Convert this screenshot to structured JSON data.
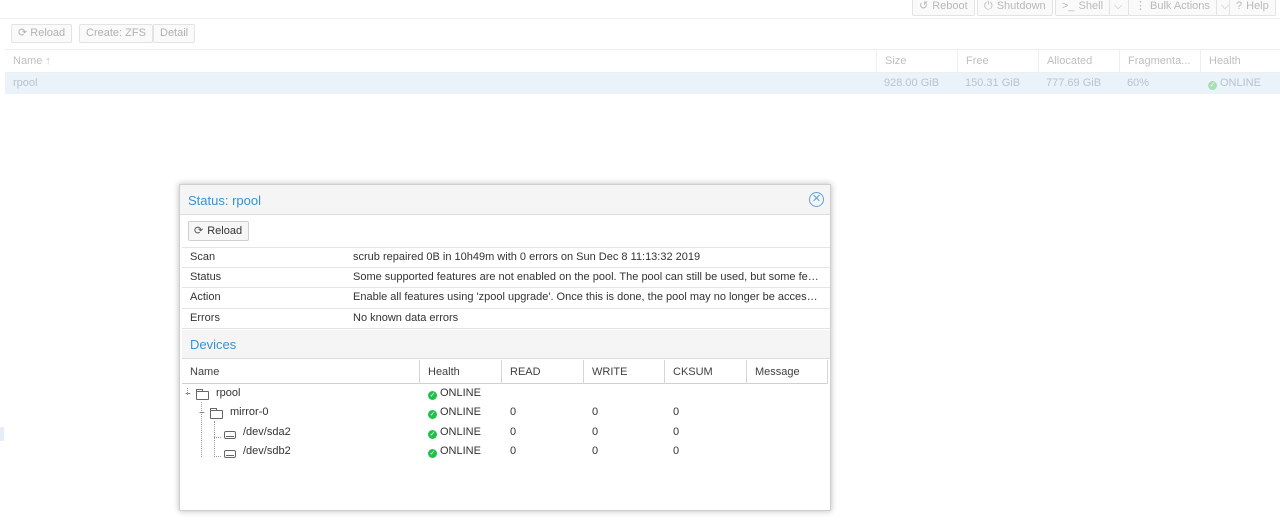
{
  "topbar": {
    "buttons": [
      {
        "icon": "undo-icon",
        "glyph": "↺",
        "label": "Reboot"
      },
      {
        "icon": "power-icon",
        "glyph": "⏻",
        "label": "Shutdown"
      },
      {
        "icon": "terminal-icon",
        "glyph": ">_",
        "label": "Shell",
        "has_dropdown": true
      },
      {
        "icon": "ellipsis-vertical-icon",
        "glyph": "⋮",
        "label": "Bulk Actions",
        "has_dropdown": true
      },
      {
        "icon": "help-icon",
        "glyph": "?",
        "label": "Help"
      }
    ]
  },
  "toolbar": {
    "reload_label": "Reload",
    "create_zfs_label": "Create: ZFS",
    "detail_label": "Detail"
  },
  "pool_grid": {
    "columns": [
      "Name ↑",
      "Size",
      "Free",
      "Allocated",
      "Fragmenta...",
      "Health"
    ],
    "rows": [
      {
        "name": "rpool",
        "size": "928.00 GiB",
        "free": "150.31 GiB",
        "allocated": "777.69 GiB",
        "fragmentation": "60%",
        "health": "ONLINE"
      }
    ]
  },
  "modal": {
    "title": "Status: rpool",
    "reload_label": "Reload",
    "status_rows": [
      {
        "key": "Scan",
        "value": "scrub repaired 0B in 10h49m with 0 errors on Sun Dec 8 11:13:32 2019"
      },
      {
        "key": "Status",
        "value": "Some supported features are not enabled on the pool. The pool can still be used, but some featur..."
      },
      {
        "key": "Action",
        "value": "Enable all features using 'zpool upgrade'. Once this is done, the pool may no longer be accessibl..."
      },
      {
        "key": "Errors",
        "value": "No known data errors"
      }
    ],
    "devices_title": "Devices",
    "devices_columns": [
      "Name",
      "Health",
      "READ",
      "WRITE",
      "CKSUM",
      "Message"
    ],
    "devices": [
      {
        "name": "rpool",
        "health": "ONLINE",
        "read": "",
        "write": "",
        "cksum": "",
        "message": ""
      },
      {
        "name": "mirror-0",
        "health": "ONLINE",
        "read": "0",
        "write": "0",
        "cksum": "0",
        "message": ""
      },
      {
        "name": "/dev/sda2",
        "health": "ONLINE",
        "read": "0",
        "write": "0",
        "cksum": "0",
        "message": ""
      },
      {
        "name": "/dev/sdb2",
        "health": "ONLINE",
        "read": "0",
        "write": "0",
        "cksum": "0",
        "message": ""
      }
    ]
  },
  "colors": {
    "accent": "#3892d4",
    "online_green": "#21bf4b",
    "selected_row": "#eaf2fa"
  }
}
